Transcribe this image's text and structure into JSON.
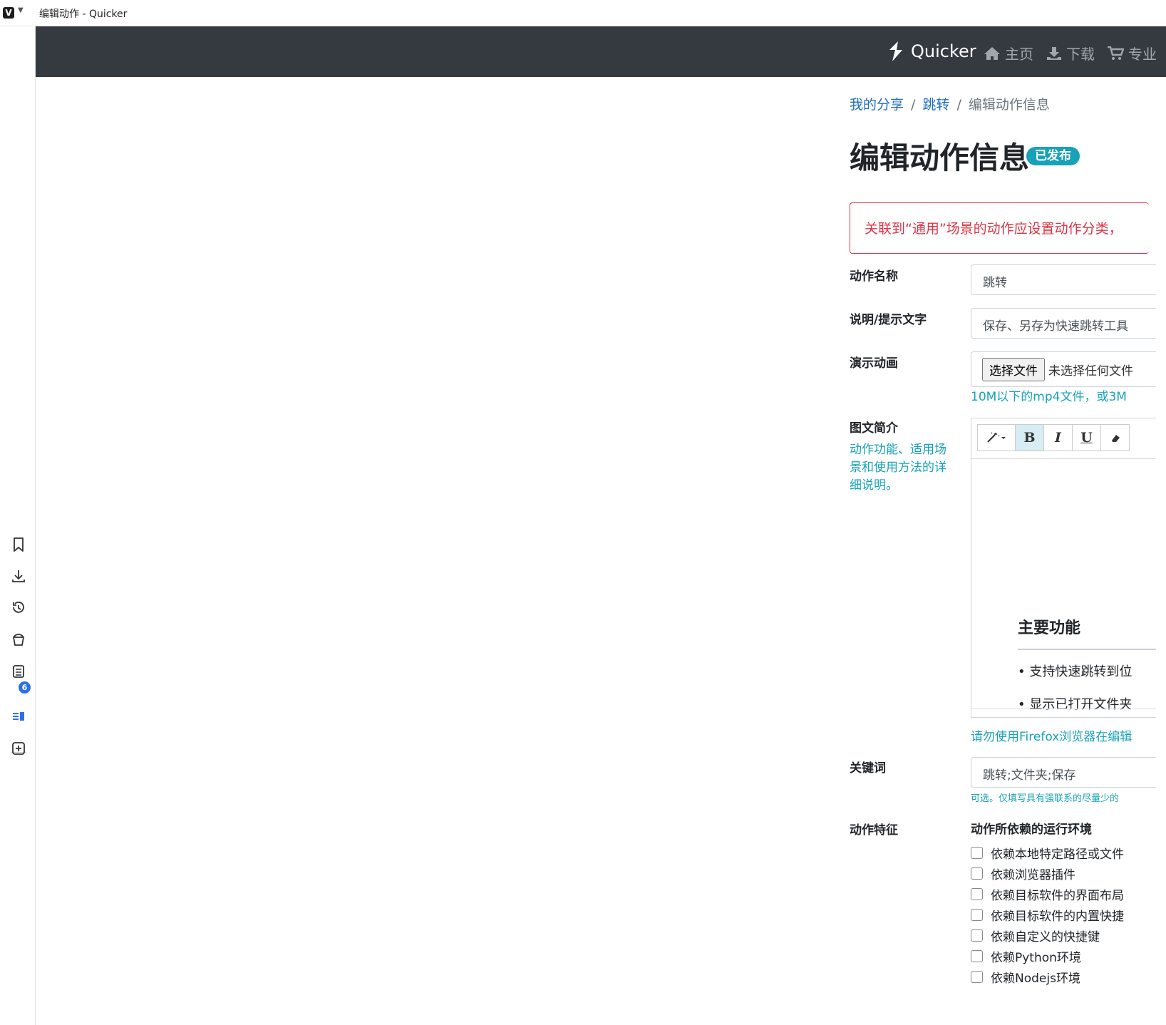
{
  "window": {
    "title": "编辑动作 - Quicker"
  },
  "side_panel": {
    "badge_count": "6"
  },
  "navbar": {
    "brand": "Quicker",
    "links": [
      {
        "label": "主页",
        "icon": "home-icon"
      },
      {
        "label": "下载",
        "icon": "download-icon"
      },
      {
        "label": "专业",
        "icon": "cart-icon"
      }
    ]
  },
  "breadcrumb": {
    "item1": "我的分享",
    "item2": "跳转",
    "current": "编辑动作信息",
    "separator": "/"
  },
  "page": {
    "title": "编辑动作信息",
    "status_badge": "已发布"
  },
  "alert": {
    "text": "关联到“通用”场景的动作应设置动作分类，"
  },
  "form": {
    "name_label": "动作名称",
    "name_value": "跳转",
    "desc_label": "说明/提示文字",
    "desc_value": "保存、另存为快速跳转工具",
    "anim_label": "演示动画",
    "file_button": "选择文件",
    "file_status": "未选择任何文件",
    "anim_help": "10M以下的mp4文件，或3M",
    "intro_label": "图文简介",
    "intro_help_lines": [
      "动作功能、适用场",
      "景和使用方法的详",
      "细说明。"
    ],
    "editor_heading": "主要功能",
    "editor_items": [
      "• 支持快速跳转到位",
      "• 显示已打开文件夹"
    ],
    "editor_hint": "请勿使用Firefox浏览器在编辑",
    "keywords_label": "关键词",
    "keywords_value": "跳转;文件夹;保存",
    "keywords_help": "可选。仅填写具有强联系的尽量少的",
    "features_label": "动作特征",
    "runtime_heading": "动作所依赖的运行环境",
    "checkboxes": [
      "依赖本地特定路径或文件",
      "依赖浏览器插件",
      "依赖目标软件的界面布局",
      "依赖目标软件的内置快捷",
      "依赖自定义的快捷键",
      "依赖Python环境",
      "依赖Nodejs环境"
    ]
  },
  "editor_toolbar": {
    "bold": "B",
    "italic": "I",
    "underline": "U"
  },
  "colors": {
    "navbar": "#343a40",
    "link": "#1f6dbe",
    "info": "#17a2b8",
    "danger": "#dc3545"
  }
}
